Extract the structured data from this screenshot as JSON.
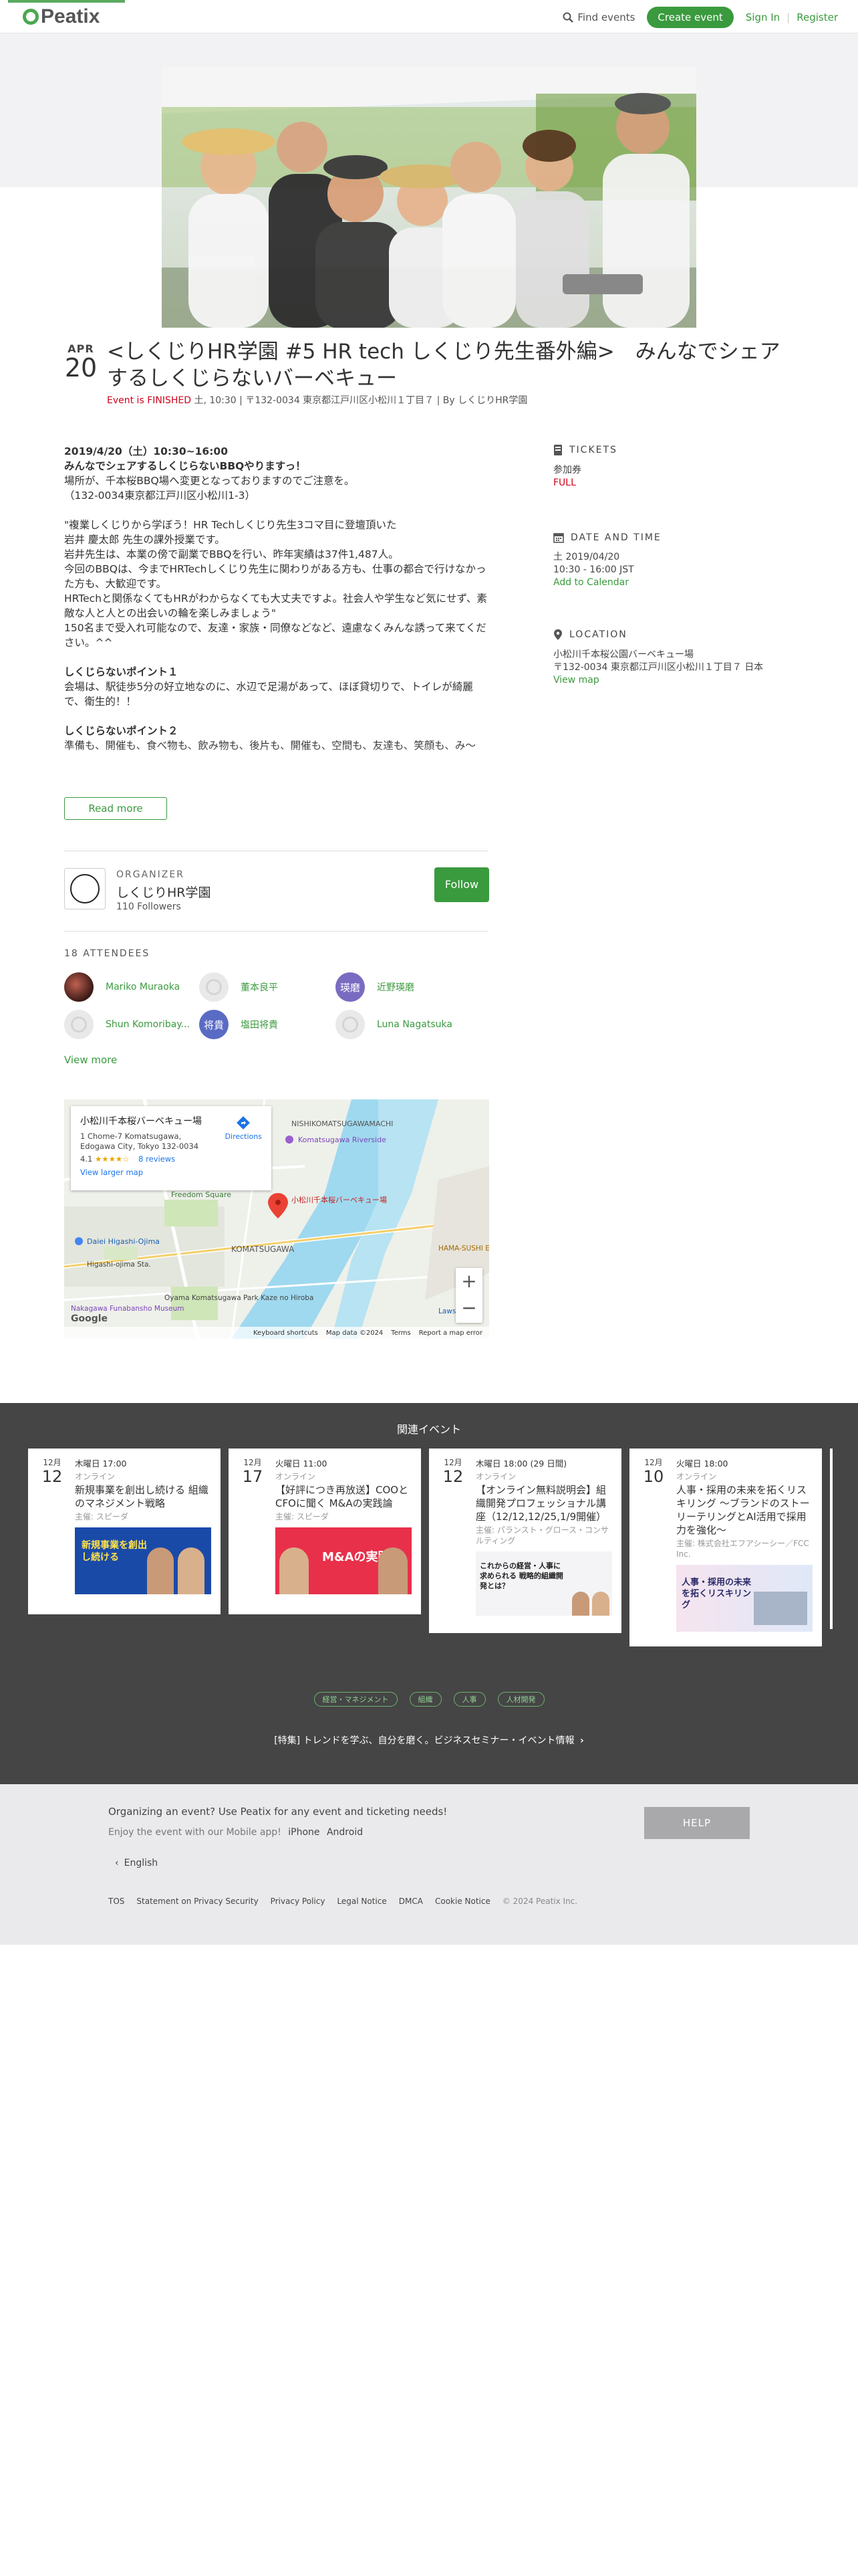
{
  "header": {
    "logo": "Peatix",
    "find_events": "Find events",
    "create_event": "Create event",
    "sign_in": "Sign In",
    "separator": "|",
    "register": "Register"
  },
  "event": {
    "month": "APR",
    "day": "20",
    "title": "<しくじりHR学園 #5 HR tech しくじり先生番外編>　みんなでシェアするしくじらないバーベキュー",
    "status": "Event is FINISHED",
    "meta": " 土, 10:30 | 〒132-0034 東京都江戸川区小松川１丁目７ | By しくじりHR学園"
  },
  "description": {
    "lines": [
      "2019/4/20（土）10:30~16:00",
      "みんなでシェアするしくじらないBBQやりますっ！",
      "場所が、千本桜BBQ場へ変更となっておりますのでご注意を。",
      "（132-0034東京都江戸川区小松川1-3）",
      "",
      "\"複業しくじりから学ぼう！HR Techしくじり先生3コマ目に登壇頂いた",
      "岩井 慶太郎 先生の課外授業です。",
      "岩井先生は、本業の傍で副業でBBQを行い、昨年実績は37件1,487人。",
      "今回のBBQは、今までHRTechしくじり先生に関わりがある方も、仕事の都合で行けなかった方も、大歓迎です。",
      "HRTechと関係なくてもHRがわからなくても大丈夫ですよ。社会人や学生など気にせず、素敵な人と人との出会いの輪を楽しみましょう\"",
      "150名まで受入れ可能なので、友達・家族・同僚などなど、遠慮なくみんな誘って来てください。^^",
      "",
      "しくじらないポイント１",
      "会場は、駅徒歩5分の好立地なのに、水辺で足湯があって、ほぼ貸切りで、トイレが綺麗で、衛生的！！",
      "",
      "しくじらないポイント２",
      "準備も、開催も、食べ物も、飲み物も、後片も、開催も、空間も、友達も、笑顔も、み～"
    ],
    "read_more": "Read more"
  },
  "sidebar": {
    "tickets": {
      "heading": "TICKETS",
      "ticket_name": "参加券",
      "ticket_status": "FULL"
    },
    "datetime": {
      "heading": "DATE AND TIME",
      "date": "土 2019/04/20",
      "time": "10:30 - 16:00 JST",
      "add_calendar": "Add to Calendar"
    },
    "location": {
      "heading": "LOCATION",
      "venue": "小松川千本桜公園バーベキュー場",
      "address": "〒132-0034 東京都江戸川区小松川１丁目７ 日本",
      "view_map": "View map"
    }
  },
  "organizer": {
    "label": "ORGANIZER",
    "name": "しくじりHR学園",
    "followers": "110 Followers",
    "follow": "Follow"
  },
  "attendees": {
    "heading": "18 ATTENDEES",
    "people": [
      {
        "name": "Mariko Muraoka",
        "initials": ""
      },
      {
        "name": "董本良平",
        "initials": ""
      },
      {
        "name": "近野瑛磨",
        "initials": "瑛磨"
      },
      {
        "name": "Shun Komoribay...",
        "initials": ""
      },
      {
        "name": "塩田将貴",
        "initials": "将貴"
      },
      {
        "name": "Luna Nagatsuka",
        "initials": ""
      }
    ],
    "view_more": "View more"
  },
  "map": {
    "card_title": "小松川千本桜バーベキュー場",
    "card_address": "1 Chome-7 Komatsugawa, Edogawa City, Tokyo 132-0034",
    "rating": "4.1",
    "stars": "★★★★☆",
    "reviews": "8 reviews",
    "directions": "Directions",
    "view_larger": "View larger map",
    "pin_label": "小松川千本桜バーベキュー場",
    "labels": {
      "nishikomatsugawa": "NISHIKOMATSUGAWAMACHI",
      "komatsugawa": "KOMATSUGAWA",
      "riverside": "Komatsugawa Riverside",
      "freedom": "Freedom Square",
      "higashi_ojima": "Daiei Higashi-Ojima",
      "higashi_station": "Higashi-ojima Sta.",
      "nakagawa": "Nakagawa Funabansho Museum",
      "park": "Oyama Komatsugawa Park Kaze no Hiroba",
      "lawson": "Lawson",
      "hamasushi": "HAMA-SUSHI Edogawa Matsue",
      "google": "Google"
    },
    "zoom_in": "+",
    "zoom_out": "−",
    "shortcuts": "Keyboard shortcuts",
    "mapdata": "Map data ©2024",
    "terms": "Terms",
    "report": "Report a map error"
  },
  "related": {
    "heading": "関連イベント",
    "cards": [
      {
        "month": "12月",
        "day": "12",
        "time": "木曜日 17:00",
        "place": "オンライン",
        "title": "新規事業を創出し続ける 組織のマネジメント戦略",
        "org": "主催: スピーダ",
        "banner": "新規事業を創出し続ける"
      },
      {
        "month": "12月",
        "day": "17",
        "time": "火曜日 11:00",
        "place": "オンライン",
        "title": "【好評につき再放送】COOとCFOに聞く M&Aの実践論",
        "org": "主催: スピーダ",
        "banner": "M&Aの実践論"
      },
      {
        "month": "12月",
        "day": "12",
        "time": "木曜日 18:00 (29 日間)",
        "place": "オンライン",
        "title": "【オンライン無料説明会】組織開発プロフェッショナル講座（12/12,12/25,1/9開催）",
        "org": "主催: パランスト・グロース・コンサルティング",
        "banner": "これからの経営・人事に求められる 戦略的組織開発とは？"
      },
      {
        "month": "12月",
        "day": "10",
        "time": "火曜日 18:00",
        "place": "オンライン",
        "title": "人事・採用の未来を拓くリスキリング ～ブランドのストーリーテリングとAI活用で採用力を強化～",
        "org": "主催: 株式会社エフアシーシー／FCC Inc.",
        "banner": "人事・採用の未来を拓くリスキリング"
      }
    ],
    "tags": [
      "経営・マネジメント",
      "組織",
      "人事",
      "人材開発"
    ],
    "special": "[特集] トレンドを学ぶ、自分を磨く。ビジネスセミナー・イベント情報",
    "special_arrow": "›"
  },
  "footer": {
    "organizing": "Organizing an event? Use Peatix for any event and ticketing needs!",
    "app_text": "Enjoy the event with our Mobile app!",
    "iphone": "iPhone",
    "android": "Android",
    "help": "HELP",
    "language": "English",
    "links": [
      "TOS",
      "Statement on Privacy Security",
      "Privacy Policy",
      "Legal Notice",
      "DMCA",
      "Cookie Notice"
    ],
    "copyright": "© 2024 Peatix Inc."
  }
}
